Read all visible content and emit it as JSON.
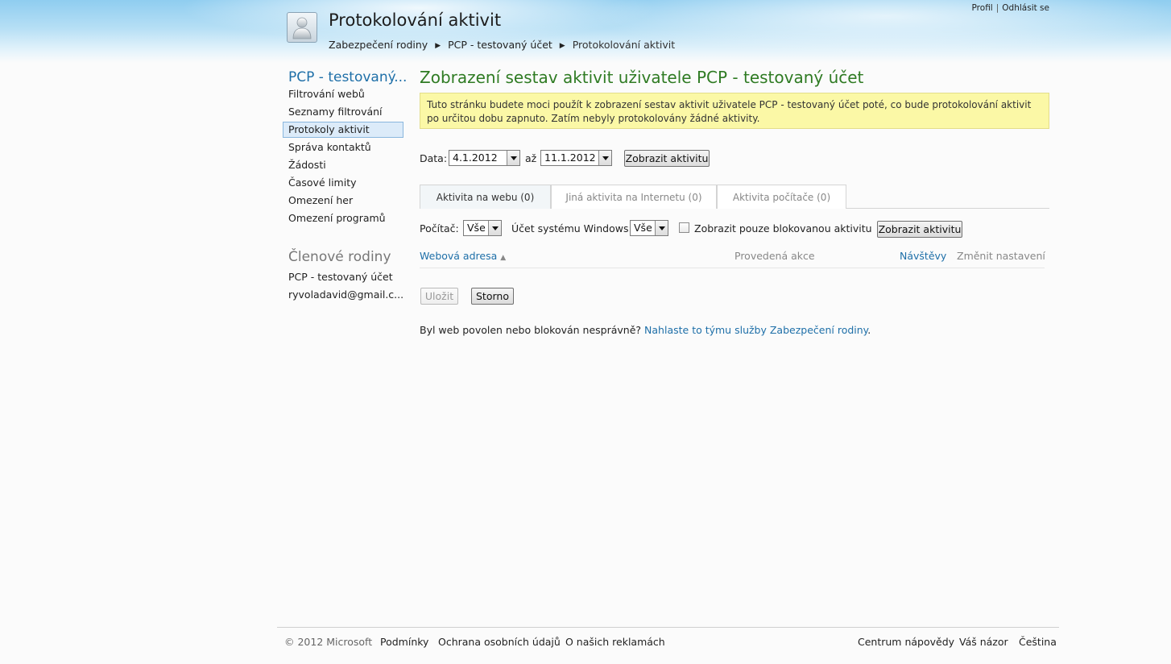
{
  "header": {
    "title": "Protokolování aktivit",
    "breadcrumb": [
      "Zabezpečení rodiny",
      "PCP - testovaný účet",
      "Protokolování aktivit"
    ],
    "top_links": {
      "profile": "Profil",
      "separator": "|",
      "logout": "Odhlásit se"
    }
  },
  "sidebar": {
    "account_title": "PCP - testovaný...",
    "items": [
      {
        "label": "Filtrování webů",
        "active": false
      },
      {
        "label": "Seznamy filtrování",
        "active": false
      },
      {
        "label": "Protokoly aktivit",
        "active": true
      },
      {
        "label": "Správa kontaktů",
        "active": false
      },
      {
        "label": "Žádosti",
        "active": false
      },
      {
        "label": "Časové limity",
        "active": false
      },
      {
        "label": "Omezení her",
        "active": false
      },
      {
        "label": "Omezení programů",
        "active": false
      }
    ],
    "family_title": "Členové rodiny",
    "family_members": [
      "PCP - testovaný účet",
      "ryvoladavid@gmail.c..."
    ]
  },
  "main": {
    "title": "Zobrazení sestav aktivit uživatele PCP - testovaný účet",
    "info": "Tuto stránku budete moci použít k zobrazení sestav aktivit uživatele PCP - testovaný účet poté, co bude protokolování aktivit po určitou dobu zapnuto. Zatím nebyly protokolovány žádné aktivity.",
    "date_filter": {
      "label": "Data:",
      "from": "4.1.2012",
      "to_label": "až",
      "to": "11.1.2012",
      "button": "Zobrazit aktivitu"
    },
    "tabs": [
      {
        "label": "Aktivita na webu (0)",
        "active": true
      },
      {
        "label": "Jiná aktivita na Internetu (0)",
        "active": false
      },
      {
        "label": "Aktivita počítače (0)",
        "active": false
      }
    ],
    "filters": {
      "computer_label": "Počítač:",
      "computer_value": "Vše",
      "account_label": "Účet systému Windows:",
      "account_value": "Vše",
      "blocked_only_label": "Zobrazit pouze blokovanou aktivitu",
      "blocked_only_checked": false,
      "button": "Zobrazit aktivitu"
    },
    "table_headers": {
      "web_address": "Webová adresa",
      "sort_indicator": "▲",
      "action": "Provedená akce",
      "visits": "Návštěvy",
      "change_settings": "Změnit nastavení"
    },
    "save_button": "Uložit",
    "cancel_button": "Storno",
    "report_text": "Byl web povolen nebo blokován nesprávně?",
    "report_link": "Nahlaste to týmu služby Zabezpečení rodiny",
    "report_end": "."
  },
  "footer": {
    "copyright": "© 2012 Microsoft",
    "links_left": [
      "Podmínky",
      "Ochrana osobních údajů",
      "O našich reklamách"
    ],
    "links_right": [
      "Centrum nápovědy",
      "Váš názor",
      "Čeština"
    ]
  }
}
